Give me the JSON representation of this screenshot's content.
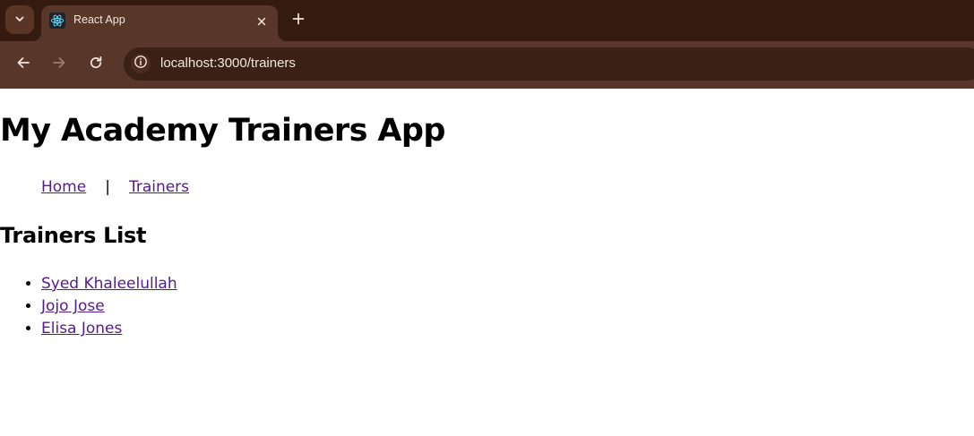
{
  "browser": {
    "tab": {
      "title": "React App",
      "favicon": "react-icon"
    },
    "address_bar": {
      "host": "localhost",
      "rest": ":3000/trainers"
    },
    "icons": {
      "tab_search": "chevron-down-icon",
      "close_tab": "close-icon",
      "new_tab": "plus-icon",
      "back": "arrow-left-icon",
      "forward": "arrow-right-icon",
      "reload": "reload-icon",
      "site_info": "info-icon"
    },
    "colors": {
      "frame": "#341a0f",
      "toolbar": "#58362a",
      "omnibox": "#3b2016",
      "link_visited": "#551a8b"
    }
  },
  "page": {
    "title": "My Academy Trainers App",
    "nav": {
      "home": "Home",
      "separator": "|",
      "trainers": "Trainers"
    },
    "section_title": "Trainers List",
    "trainers": [
      "Syed Khaleelullah",
      "Jojo Jose",
      "Elisa Jones"
    ]
  }
}
